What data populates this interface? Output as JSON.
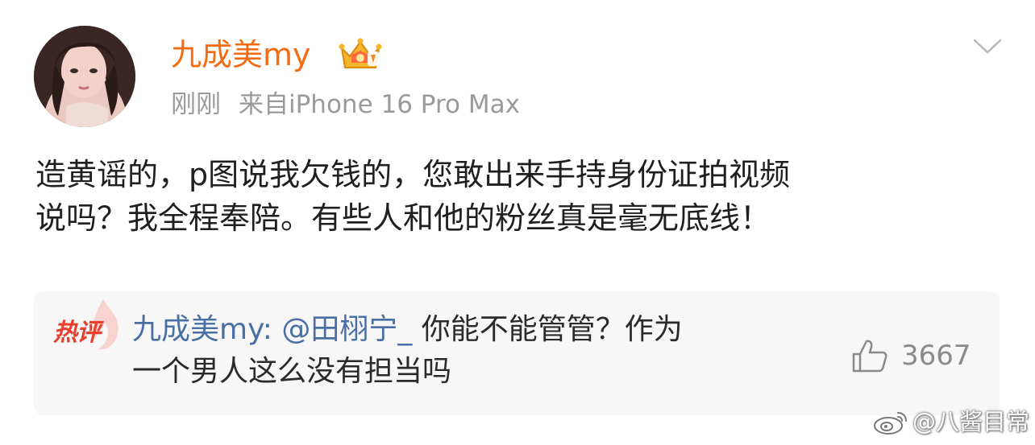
{
  "post": {
    "author": {
      "name": "九成美my",
      "badge_icon": "crown-badge-icon"
    },
    "meta": {
      "time": "刚刚",
      "source": "来自iPhone 16 Pro Max"
    },
    "text_lines": [
      "造黄谣的，p图说我欠钱的，您敢出来手持身份证拍视频",
      "说吗？我全程奉陪。有些人和他的粉丝真是毫无底线！"
    ],
    "more_icon": "chevron-down-icon"
  },
  "hot_comment": {
    "badge_label": "热评",
    "author_prefix": "九成美my: ",
    "mention": "@田栩宁_",
    "text_line1": " 你能不能管管？作为",
    "text_line2": "一个男人这么没有担当吗",
    "like_icon": "thumbs-up-icon",
    "like_count": "3667"
  },
  "watermark": {
    "icon": "weibo-logo-icon",
    "text": "@八酱目常"
  },
  "colors": {
    "username": "#f56b12",
    "meta": "#9a9a9a",
    "body_text": "#1f1f1f",
    "mention_link": "#4a6fa5",
    "hot_badge": "#e8402e",
    "hot_box_bg": "#f7f7f7"
  }
}
